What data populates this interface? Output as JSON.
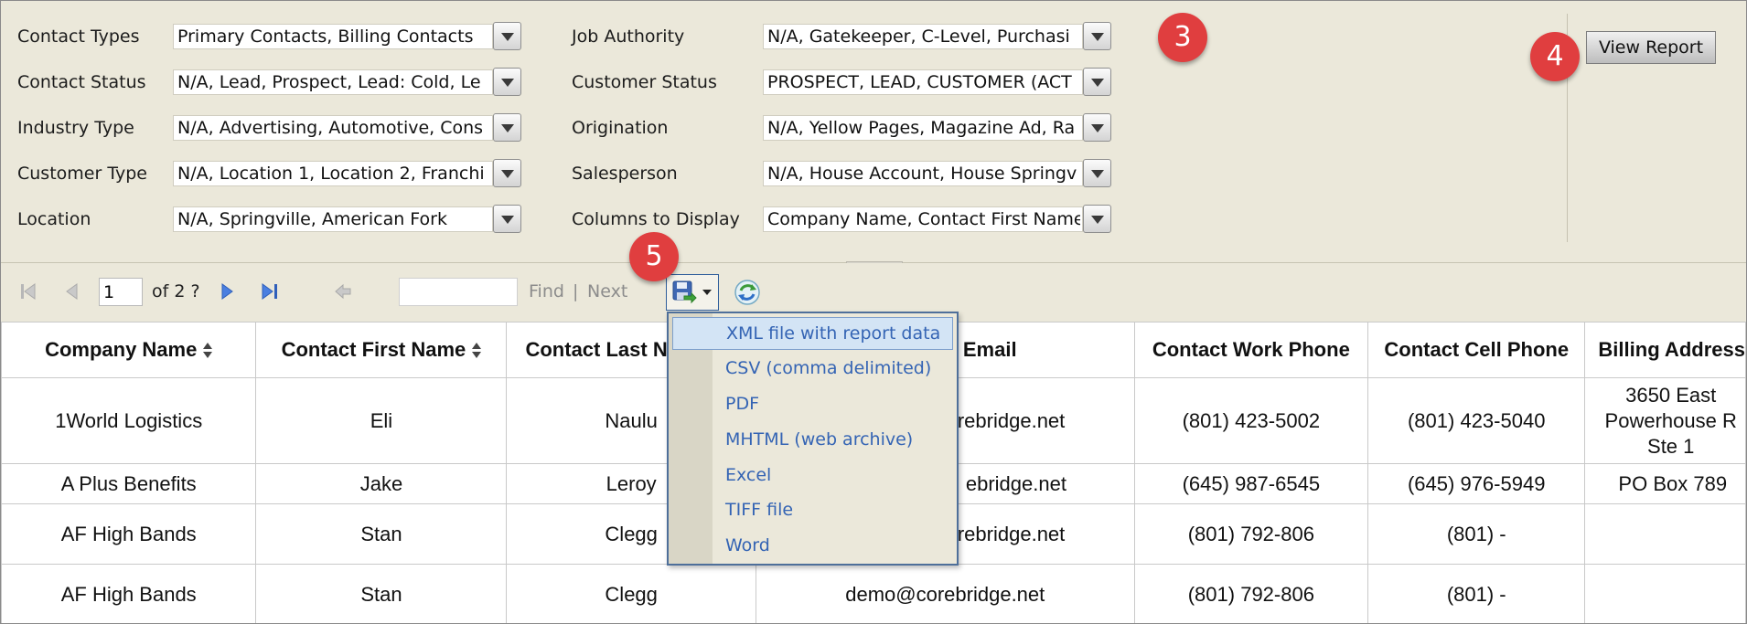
{
  "params": {
    "left": [
      {
        "label": "Contact Types",
        "value": "Primary Contacts, Billing Contacts"
      },
      {
        "label": "Contact Status",
        "value": "N/A, Lead, Prospect, Lead: Cold, Le"
      },
      {
        "label": "Industry Type",
        "value": "N/A, Advertising, Automotive, Cons"
      },
      {
        "label": "Customer Type",
        "value": "N/A, Location 1, Location 2, Franchi"
      },
      {
        "label": "Location",
        "value": "N/A, Springville, American Fork"
      }
    ],
    "right": [
      {
        "label": "Job Authority",
        "value": "N/A, Gatekeeper, C-Level, Purchasi"
      },
      {
        "label": "Customer Status",
        "value": "PROSPECT, LEAD, CUSTOMER (ACT"
      },
      {
        "label": "Origination",
        "value": "N/A, Yellow Pages, Magazine Ad, Ra"
      },
      {
        "label": "Salesperson",
        "value": "N/A, House Account, House Springv"
      },
      {
        "label": "Columns to Display",
        "value": "Company Name, Contact First Name"
      }
    ],
    "view_report_label": "View Report"
  },
  "badges": {
    "b3": "3",
    "b4": "4",
    "b5": "5"
  },
  "toolbar": {
    "page_value": "1",
    "of_pages": "of 2 ?",
    "find_label": "Find",
    "separator": "|",
    "next_label": "Next"
  },
  "export_menu": {
    "items": [
      "XML file with report data",
      "CSV (comma delimited)",
      "PDF",
      "MHTML (web archive)",
      "Excel",
      "TIFF file",
      "Word"
    ],
    "highlighted_index": 0
  },
  "table": {
    "columns": [
      "Company Name",
      "Contact First Name",
      "Contact Last N",
      "Email",
      "Contact Work Phone",
      "Contact Cell Phone",
      "Billing Address"
    ],
    "rows": [
      [
        "1World Logistics",
        "Eli",
        "Naulu",
        "rebridge.net",
        "(801) 423-5002",
        "(801) 423-5040",
        "3650 East Powerhouse R Ste 1"
      ],
      [
        "A Plus Benefits",
        "Jake",
        "Leroy",
        "ebridge.net",
        "(645) 987-6545",
        "(645) 976-5949",
        "PO Box 789"
      ],
      [
        "AF High Bands",
        "Stan",
        "Clegg",
        "rebridge.net",
        "(801) 792-806",
        "(801) -",
        ""
      ],
      [
        "AF High Bands",
        "Stan",
        "Clegg",
        "demo@corebridge.net",
        "(801) 792-806",
        "(801) -",
        ""
      ]
    ]
  },
  "colors": {
    "panel_bg": "#ebe8da",
    "badge_red": "#e03e3f",
    "menu_link": "#3464b4",
    "menu_highlight": "#d3e4f5"
  }
}
